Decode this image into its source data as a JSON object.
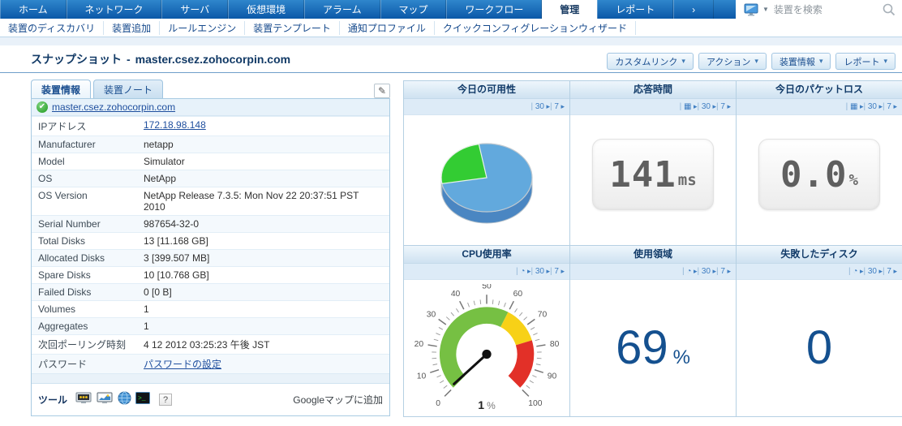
{
  "nav": {
    "tabs": [
      {
        "label": "ホーム"
      },
      {
        "label": "ネットワーク"
      },
      {
        "label": "サーバ"
      },
      {
        "label": "仮想環境"
      },
      {
        "label": "アラーム"
      },
      {
        "label": "マップ"
      },
      {
        "label": "ワークフロー"
      },
      {
        "label": "管理",
        "active": true
      },
      {
        "label": "レポート"
      },
      {
        "label": "›",
        "chevron": true
      }
    ],
    "search_placeholder": "装置を検索"
  },
  "menu": {
    "items": [
      {
        "label": "装置のディスカバリ"
      },
      {
        "label": "装置追加"
      },
      {
        "label": "ルールエンジン"
      },
      {
        "label": "装置テンプレート"
      },
      {
        "label": "通知プロファイル"
      },
      {
        "label": "クイックコンフィグレーションウィザード"
      }
    ]
  },
  "page": {
    "title_prefix": "スナップショット",
    "title_separator": "-",
    "device_name": "master.csez.zohocorpin.com"
  },
  "action_buttons": [
    {
      "label": "カスタムリンク"
    },
    {
      "label": "アクション"
    },
    {
      "label": "装置情報"
    },
    {
      "label": "レポート"
    }
  ],
  "caret_glyph": "▾",
  "edit_icon_glyph": "✎",
  "check_glyph": "✔",
  "help_glyph": "?",
  "device_panel": {
    "tabs": [
      {
        "label": "装置情報",
        "active": true
      },
      {
        "label": "装置ノート"
      }
    ],
    "device_link": "master.csez.zohocorpin.com",
    "rows": [
      {
        "label": "IPアドレス",
        "value": "172.18.98.148",
        "link": true
      },
      {
        "label": "Manufacturer",
        "value": "netapp"
      },
      {
        "label": "Model",
        "value": "Simulator"
      },
      {
        "label": "OS",
        "value": "NetApp"
      },
      {
        "label": "OS Version",
        "value": "NetApp Release 7.3.5: Mon Nov 22 20:37:51 PST 2010"
      },
      {
        "label": "Serial Number",
        "value": "987654-32-0"
      },
      {
        "label": "Total Disks",
        "value": "13 [11.168 GB]"
      },
      {
        "label": "Allocated Disks",
        "value": "3 [399.507 MB]"
      },
      {
        "label": "Spare Disks",
        "value": "10 [10.768 GB]"
      },
      {
        "label": "Failed Disks",
        "value": "0 [0 B]"
      },
      {
        "label": "Volumes",
        "value": "1"
      },
      {
        "label": "Aggregates",
        "value": "1"
      },
      {
        "label": "次回ポーリング時刻",
        "value": "4 12 2012 03:25:23 午後 JST"
      },
      {
        "label": "パスワード",
        "value": "パスワードの設定",
        "link": true
      }
    ],
    "tools_label": "ツール",
    "tools_icons": [
      "password-tool-icon",
      "performance-monitor-icon",
      "web-globe-icon",
      "terminal-icon"
    ],
    "google_map_link": "Googleマップに追加"
  },
  "widgets": {
    "availability": {
      "title": "今日の可用性",
      "links": [
        {
          "text": "30"
        },
        {
          "text": "7"
        }
      ],
      "pie": {
        "green_pct": 25,
        "blue_pct": 75,
        "start_deg": 100,
        "blue_color": "#62a9dd",
        "blue_dark": "#4a86c2",
        "green_color": "#33cc33",
        "green_dark": "#26a426"
      }
    },
    "response_time": {
      "title": "応答時間",
      "links": [
        {
          "icon": "report-chart-icon",
          "glyph": "▦"
        },
        {
          "text": "30"
        },
        {
          "text": "7"
        }
      ],
      "value": "141",
      "unit": "ms"
    },
    "packet_loss": {
      "title": "今日のパケットロス",
      "links": [
        {
          "icon": "report-chart-icon",
          "glyph": "▦"
        },
        {
          "text": "30"
        },
        {
          "text": "7"
        }
      ],
      "value": "0.0",
      "unit": "%"
    },
    "cpu": {
      "title": "CPU使用率",
      "links": [
        {
          "icon": "history-clock-icon",
          "glyph": "◔"
        },
        {
          "text": "30"
        },
        {
          "text": "7"
        }
      ],
      "gauge_value": 1,
      "value_label": "1",
      "unit": "%",
      "tick_labels": [
        0,
        10,
        20,
        30,
        40,
        50,
        60,
        70,
        80,
        90,
        100
      ],
      "zones": [
        {
          "to": 60,
          "color": "#76c043"
        },
        {
          "to": 77,
          "color": "#f7d117"
        },
        {
          "to": 100,
          "color": "#e23028"
        }
      ]
    },
    "disk_usage": {
      "title": "使用領域",
      "links": [
        {
          "icon": "history-clock-icon",
          "glyph": "◔"
        },
        {
          "text": "30"
        },
        {
          "text": "7"
        }
      ],
      "value": "69",
      "unit": "%"
    },
    "failed_disks": {
      "title": "失敗したディスク",
      "links": [
        {
          "icon": "history-clock-icon",
          "glyph": "◔"
        },
        {
          "text": "30"
        },
        {
          "text": "7"
        }
      ],
      "value": "0"
    }
  }
}
